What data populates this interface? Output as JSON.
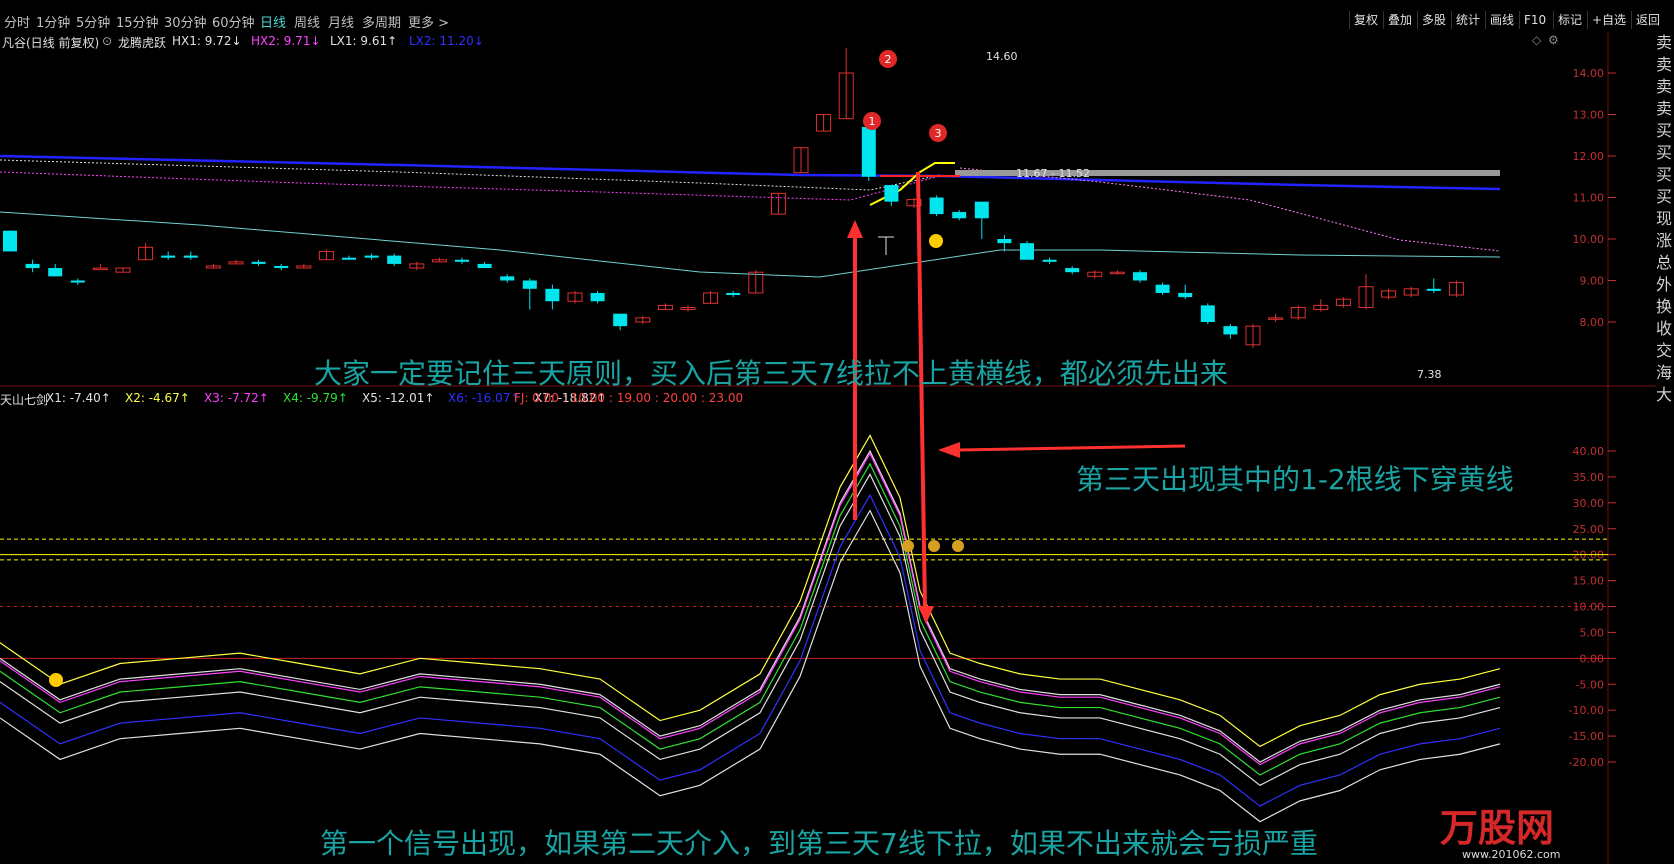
{
  "toolbar": {
    "top_fragments": [
      "分时",
      "1分钟",
      "5分钟",
      "15分钟",
      "30分钟",
      "60分钟",
      "日线",
      "周线",
      "月线",
      "多周期",
      "更多 >"
    ],
    "active_period": "日线",
    "right_buttons": [
      "复权",
      "叠加",
      "多股",
      "统计",
      "画线",
      "F10",
      "标记",
      "+自选",
      "返回"
    ]
  },
  "main_chart": {
    "stock_title": "凡谷(日线 前复权)",
    "indicator_name": "龙腾虎跃",
    "indicators": [
      {
        "label": "HX1: 9.72",
        "color": "#e0e0e0",
        "arrow": "↓"
      },
      {
        "label": "HX2: 9.71",
        "color": "#ff40ff",
        "arrow": "↓"
      },
      {
        "label": "LX1: 9.61",
        "color": "#e0e0e0",
        "arrow": "↑"
      },
      {
        "label": "LX2: 11.20",
        "color": "#3030ff",
        "arrow": "↓"
      }
    ],
    "high_label": "14.60",
    "low_label": "7.38",
    "price_label": "11.67 - 11.52",
    "y_ticks": [
      "14.00",
      "13.00",
      "12.00",
      "11.00",
      "10.00",
      "9.00",
      "8.00"
    ],
    "circle_markers": [
      "1",
      "2",
      "3"
    ]
  },
  "sub_chart": {
    "name": "天山七剑",
    "series": [
      {
        "label": "X1: -7.40",
        "color": "#e0e0e0",
        "arrow": "↑"
      },
      {
        "label": "X2: -4.67",
        "color": "#ffff40",
        "arrow": "↑"
      },
      {
        "label": "X3: -7.72",
        "color": "#ff40ff",
        "arrow": "↑"
      },
      {
        "label": "X4: -9.79",
        "color": "#30e030",
        "arrow": "↑"
      },
      {
        "label": "X5: -12.01",
        "color": "#e0e0e0",
        "arrow": "↑"
      },
      {
        "label": "X6: -16.07",
        "color": "#3030ff",
        "arrow": "↑"
      },
      {
        "label": "X7: -18.82",
        "color": "#e0e0e0",
        "arrow": "↑"
      }
    ],
    "fj": "FJ: 0.00 : 10.00 : 19.00 : 20.00 : 23.00",
    "y_ticks": [
      "40.00",
      "35.00",
      "30.00",
      "25.00",
      "20.00",
      "15.00",
      "10.00",
      "5.00",
      "0.00",
      "-5.00",
      "-10.00",
      "-15.00",
      "-20.00"
    ]
  },
  "annotations": {
    "top": "大家一定要记住三天原则，买入后第三天7线拉不上黄横线，都必须先出来",
    "middle": "第三天出现其中的1-2根线下穿黄线",
    "bottom": "第一个信号出现，如果第二天介入，到第三天7线下拉，如果不出来就会亏损严重"
  },
  "sidebar": {
    "chars": "卖卖卖卖买买买买现涨总外换收交海大"
  },
  "watermark": {
    "name": "万股网",
    "url": "www.201062.com"
  },
  "colors": {
    "up": "#e03030",
    "down": "#00e5ee",
    "yellow": "#ffff00",
    "accent": "#4cd4d4"
  }
}
